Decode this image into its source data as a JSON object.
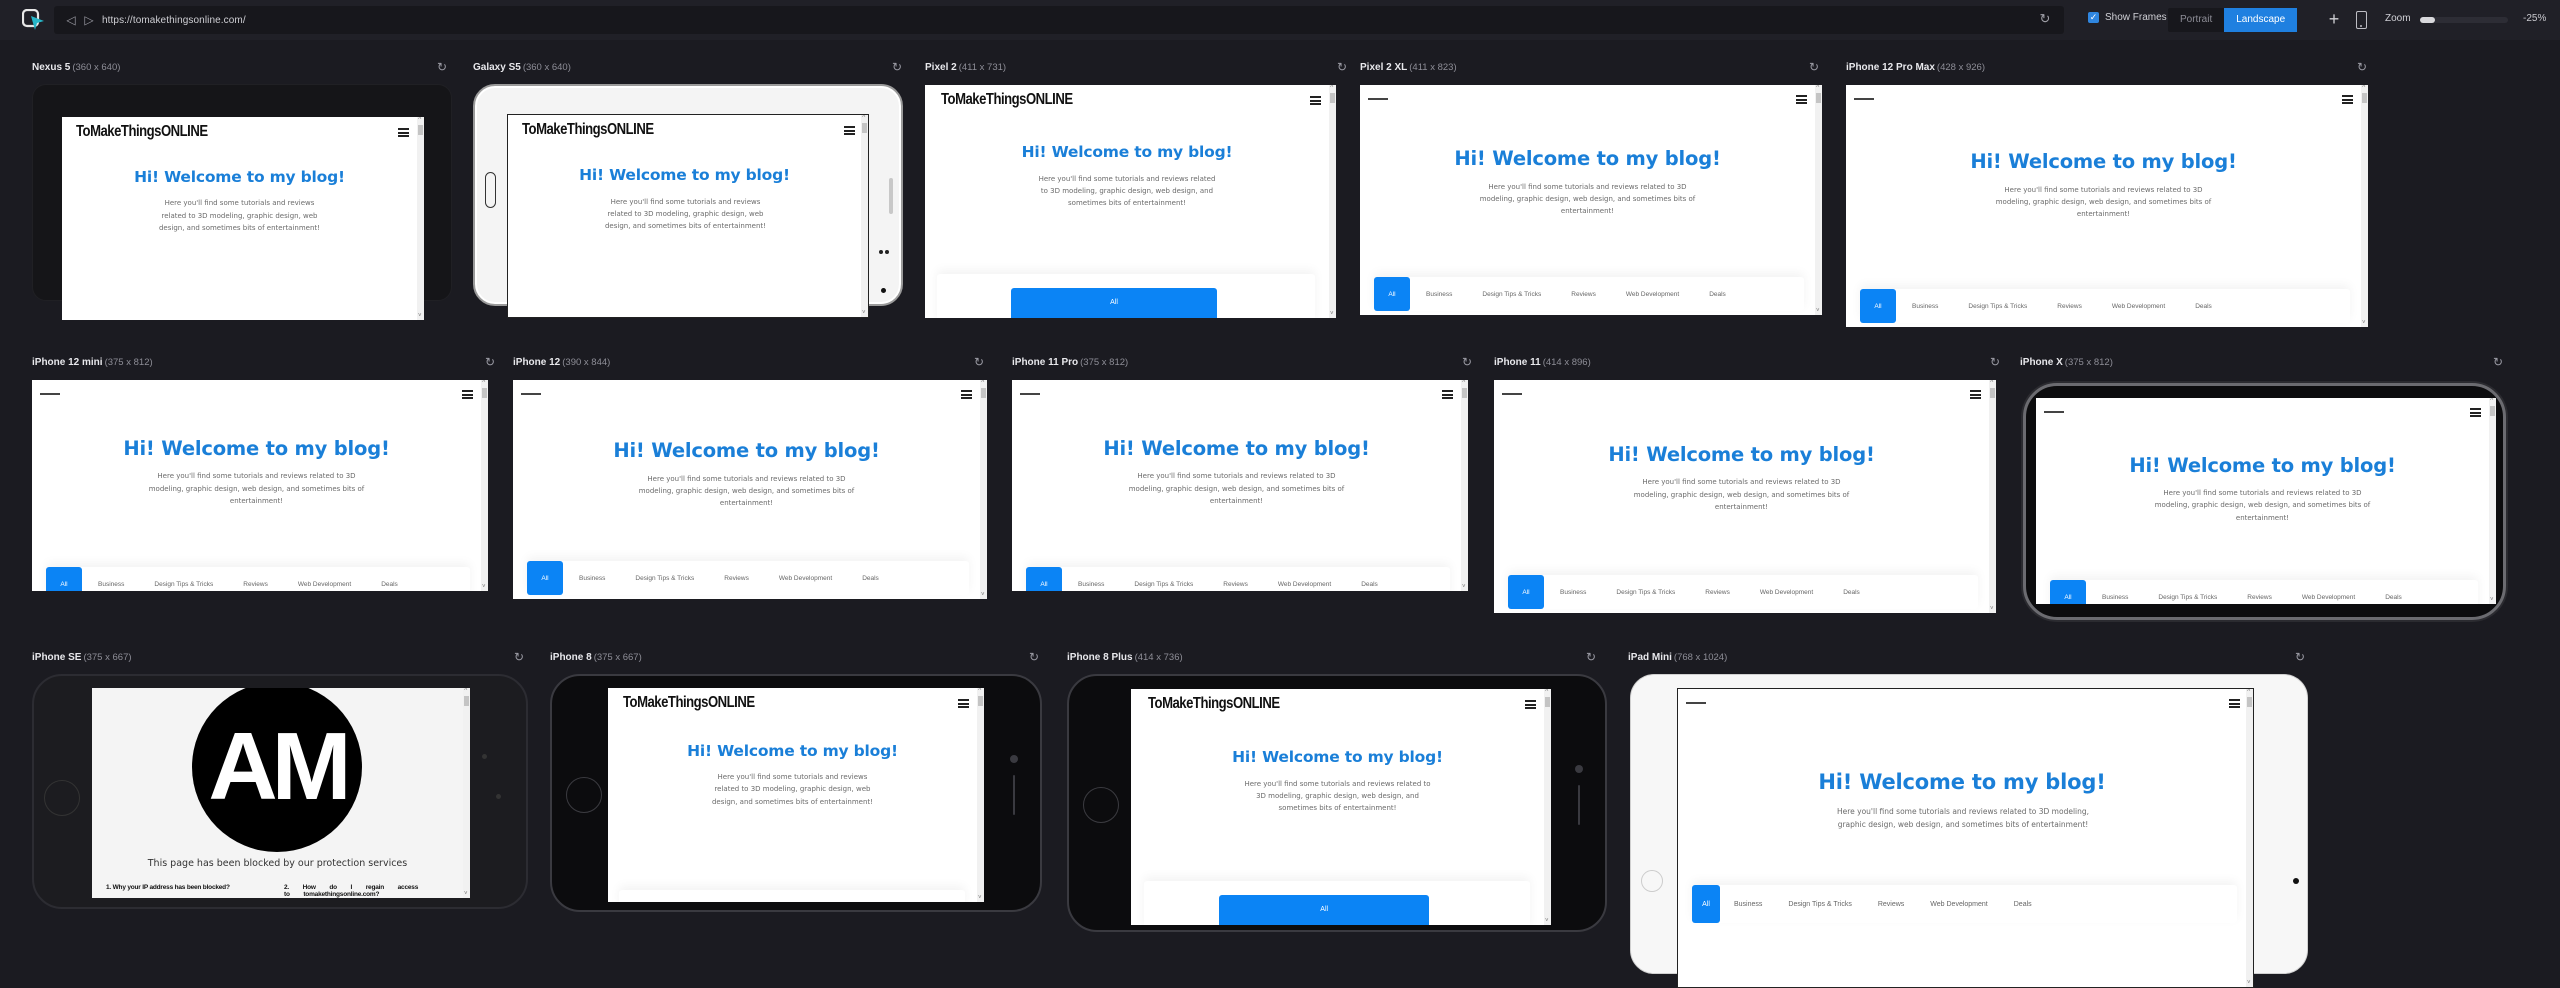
{
  "toolbar": {
    "url": "https://tomakethingsonline.com/",
    "show_frames_label": "Show Frames",
    "show_frames_checked": true,
    "orientation_options": [
      "Portrait",
      "Landscape"
    ],
    "orientation_selected": "Landscape",
    "zoom_label": "Zoom",
    "zoom_value": "-25%",
    "zoom_fill_fraction": 0.17,
    "icons": {
      "logo": "app-logo-icon",
      "back": "back-arrow-icon",
      "forward": "forward-arrow-icon",
      "reload": "reload-icon",
      "add": "plus-icon",
      "device": "device-phone-icon"
    }
  },
  "site": {
    "logo_text": "ToMakeThingsONLINE",
    "hero_title": "Hi! Welcome to my blog!",
    "hero_text": "Here you'll find some tutorials and reviews related to 3D modeling, graphic design, web design, and sometimes bits of entertainment!",
    "categories": [
      "All",
      "Business",
      "Design Tips & Tricks",
      "Reviews",
      "Web Development",
      "Deals"
    ],
    "accent_color": "#0b84f5",
    "title_color": "#1a7fd8"
  },
  "blocked_page": {
    "logo_text": "AM",
    "message": "This page has been blocked by our protection services",
    "faq_1": "1. Why your IP address has been blocked?",
    "faq_2": "2. How do I regain access to tomakethingsonline.com?"
  },
  "devices": [
    {
      "name": "Nexus 5",
      "size": "(360 x 640)"
    },
    {
      "name": "Galaxy S5",
      "size": "(360 x 640)"
    },
    {
      "name": "Pixel 2",
      "size": "(411 x 731)"
    },
    {
      "name": "Pixel 2 XL",
      "size": "(411 x 823)"
    },
    {
      "name": "iPhone 12 Pro Max",
      "size": "(428 x 926)"
    },
    {
      "name": "iPhone 12 mini",
      "size": "(375 x 812)"
    },
    {
      "name": "iPhone 12",
      "size": "(390 x 844)"
    },
    {
      "name": "iPhone 11 Pro",
      "size": "(375 x 812)"
    },
    {
      "name": "iPhone 11",
      "size": "(414 x 896)"
    },
    {
      "name": "iPhone X",
      "size": "(375 x 812)"
    },
    {
      "name": "iPhone SE",
      "size": "(375 x 667)"
    },
    {
      "name": "iPhone 8",
      "size": "(375 x 667)"
    },
    {
      "name": "iPhone 8 Plus",
      "size": "(414 x 736)"
    },
    {
      "name": "iPad Mini",
      "size": "(768 x 1024)"
    }
  ]
}
